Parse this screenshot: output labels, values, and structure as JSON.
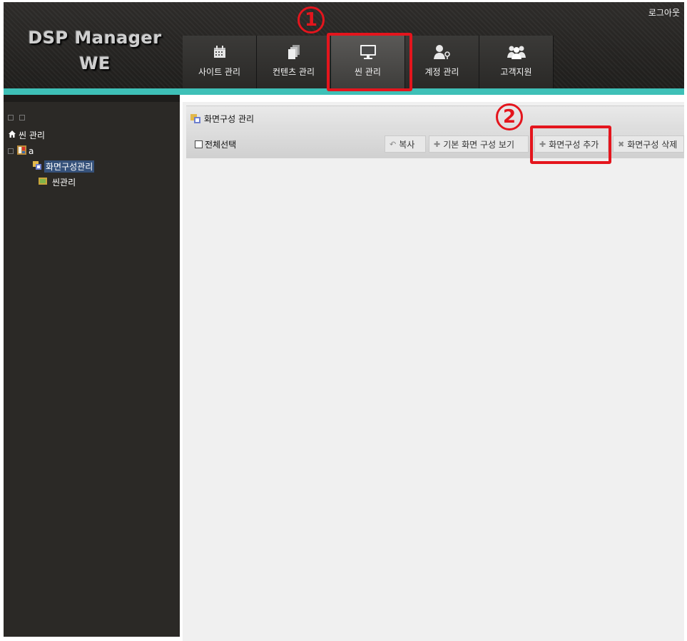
{
  "header": {
    "logo_line1": "DSP Manager",
    "logo_line2": "WE",
    "logout_label": "로그아웃",
    "accent_color": "#3ec0b7"
  },
  "nav": [
    {
      "label": "사이트 관리",
      "icon": "calendar-icon"
    },
    {
      "label": "컨텐츠 관리",
      "icon": "stacked-pages-icon"
    },
    {
      "label": "씬 관리",
      "icon": "monitor-icon",
      "active": true
    },
    {
      "label": "계정 관리",
      "icon": "user-key-icon"
    },
    {
      "label": "고객지원",
      "icon": "users-icon"
    }
  ],
  "sidebar": {
    "root_label": "씬 관리",
    "site_label": "a",
    "items": [
      {
        "label": "화면구성관리",
        "selected": true
      },
      {
        "label": "씬관리"
      }
    ]
  },
  "main": {
    "title": "화면구성 관리",
    "select_all_label": "전체선택",
    "buttons": {
      "copy": "복사",
      "view_default": "기본 화면 구성 보기",
      "add": "화면구성 추가",
      "delete": "화면구성 삭제"
    }
  },
  "annotations": {
    "marker1": "1",
    "marker2": "2",
    "color": "#e4151d"
  }
}
